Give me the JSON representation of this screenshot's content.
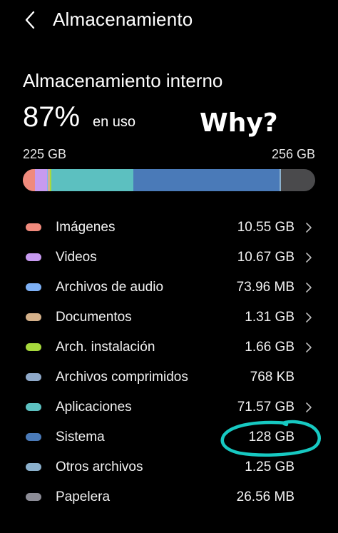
{
  "header": {
    "title": "Almacenamiento",
    "back_icon": "chevron-left-icon"
  },
  "storage": {
    "section_title": "Almacenamiento interno",
    "percent": "87%",
    "in_use_label": "en uso",
    "used": "225 GB",
    "total": "256 GB",
    "used_fraction": 0.879
  },
  "annotation": {
    "text": "Why?",
    "circle_color": "#17c9c2"
  },
  "categories": [
    {
      "label": "Imágenes",
      "size": "10.55 GB",
      "color": "#f08a7c",
      "chevron": true
    },
    {
      "label": "Videos",
      "size": "10.67 GB",
      "color": "#c79af0",
      "chevron": true
    },
    {
      "label": "Archivos de audio",
      "size": "73.96 MB",
      "color": "#7db0f5",
      "chevron": true
    },
    {
      "label": "Documentos",
      "size": "1.31 GB",
      "color": "#d4b089",
      "chevron": true
    },
    {
      "label": "Arch. instalación",
      "size": "1.66 GB",
      "color": "#a6d83c",
      "chevron": true
    },
    {
      "label": "Archivos comprimidos",
      "size": "768 KB",
      "color": "#8fa9c9",
      "chevron": false
    },
    {
      "label": "Aplicaciones",
      "size": "71.57 GB",
      "color": "#5cc0c0",
      "chevron": true
    },
    {
      "label": "Sistema",
      "size": "128 GB",
      "color": "#4a7ab8",
      "chevron": false
    },
    {
      "label": "Otros archivos",
      "size": "1.25 GB",
      "color": "#8bb0cc",
      "chevron": false
    },
    {
      "label": "Papelera",
      "size": "26.56 MB",
      "color": "#8c8c96",
      "chevron": false
    }
  ],
  "bar_segments": [
    {
      "name": "Imágenes",
      "gb": 10.55,
      "color": "#f08a7c"
    },
    {
      "name": "Videos",
      "gb": 10.67,
      "color": "#c79af0"
    },
    {
      "name": "Archivos de audio",
      "gb": 0.07,
      "color": "#7db0f5"
    },
    {
      "name": "Documentos",
      "gb": 1.31,
      "color": "#d4b089"
    },
    {
      "name": "Arch. instalación",
      "gb": 1.66,
      "color": "#a6d83c"
    },
    {
      "name": "Aplicaciones",
      "gb": 71.57,
      "color": "#5cc0c0"
    },
    {
      "name": "Sistema",
      "gb": 128,
      "color": "#4a7ab8"
    },
    {
      "name": "Otros archivos",
      "gb": 1.25,
      "color": "#8bb0cc"
    }
  ]
}
